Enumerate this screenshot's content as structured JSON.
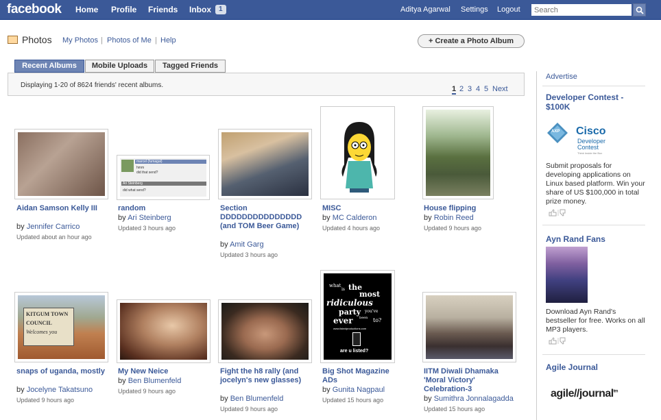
{
  "topbar": {
    "logo": "facebook",
    "nav": [
      "Home",
      "Profile",
      "Friends",
      "Inbox"
    ],
    "inbox_count": "1",
    "user": "Aditya Agarwal",
    "settings": "Settings",
    "logout": "Logout",
    "search_placeholder": "Search"
  },
  "header": {
    "title": "Photos",
    "links": [
      "My Photos",
      "Photos of Me",
      "Help"
    ],
    "separator": "|",
    "create_button": "+ Create a Photo Album"
  },
  "tabs": [
    "Recent Albums",
    "Mobile Uploads",
    "Tagged Friends"
  ],
  "info": {
    "text": "Displaying 1-20 of 8624 friends' recent albums.",
    "pages": [
      "1",
      "2",
      "3",
      "4",
      "5"
    ],
    "next": "Next"
  },
  "albums": [
    {
      "title": "Aidan Samson Kelly III",
      "by_prefix": "by ",
      "author": "Jennifer Carrico",
      "updated": "Updated about an hour ago"
    },
    {
      "title": "random",
      "by_prefix": "by ",
      "author": "Ari Steinberg",
      "updated": "Updated 3 hours ago"
    },
    {
      "title": "Section DDDDDDDDDDDDDDD (and TOM Beer Game)",
      "by_prefix": "by ",
      "author": "Amit Garg",
      "updated": "Updated 3 hours ago"
    },
    {
      "title": "MISC",
      "by_prefix": "by ",
      "author": "MC Calderon",
      "updated": "Updated 4 hours ago"
    },
    {
      "title": "House flipping",
      "by_prefix": "by ",
      "author": "Robin Reed",
      "updated": "Updated 9 hours ago"
    },
    {
      "title": "snaps of uganda, mostly",
      "by_prefix": "by ",
      "author": "Jocelyne Takatsuno",
      "updated": "Updated 9 hours ago"
    },
    {
      "title": "My New Neice",
      "by_prefix": "by ",
      "author": "Ben Blumenfeld",
      "updated": "Updated 9 hours ago"
    },
    {
      "title": "Fight the h8 rally (and jocelyn's new glasses)",
      "by_prefix": "by ",
      "author": "Ben Blumenfeld",
      "updated": "Updated 9 hours ago"
    },
    {
      "title": "Big Shot Magazine ADs",
      "by_prefix": "by ",
      "author": "Gunita Nagpaul",
      "updated": "Updated 15 hours ago"
    },
    {
      "title": "IITM Diwali Dhamaka 'Moral Victory' Celebration-3",
      "by_prefix": "by ",
      "author": "Sumithra Jonnalagadda",
      "updated": "Updated 15 hours ago"
    }
  ],
  "thumb_text": {
    "random": {
      "name1": "marcel (fumagal)",
      "line1": "hmm",
      "line2": "did that send?",
      "name2": "Ari Steinberg",
      "line3": "did what send?"
    },
    "uganda": {
      "sign1": "KITGUM TOWN",
      "sign2": "COUNCIL",
      "sign3": "Welcomes you"
    },
    "bigshot": {
      "t1": "what",
      "t2": "is",
      "t3": "the",
      "t4": "most",
      "t5": "ridiculous",
      "t6": "party",
      "t7": "you've",
      "t8": "ever",
      "t9": "been",
      "t10": "to?",
      "url": "www.listedproductions.com",
      "t11": "are u listed?"
    }
  },
  "sidebar": {
    "advertise": "Advertise",
    "ads": [
      {
        "title": "Developer Contest - $100K",
        "text": "Submit proposals for developing applications on Linux based platform. Win your share of US $100,000 in total prize money.",
        "logo_main": "Cisco",
        "logo_sub1": "Developer",
        "logo_sub2": "Contest",
        "logo_tag": "Think Inside the Box",
        "badge": "AXP"
      },
      {
        "title": "Ayn Rand Fans",
        "text": "Download Ayn Rand's bestseller for free. Works on all MP3 players."
      },
      {
        "title": "Agile Journal",
        "logo": "agile//journal",
        "logo_suffix": "tm"
      }
    ]
  },
  "colors": {
    "brand": "#3b5998",
    "tab_active": "#6d84b4"
  }
}
